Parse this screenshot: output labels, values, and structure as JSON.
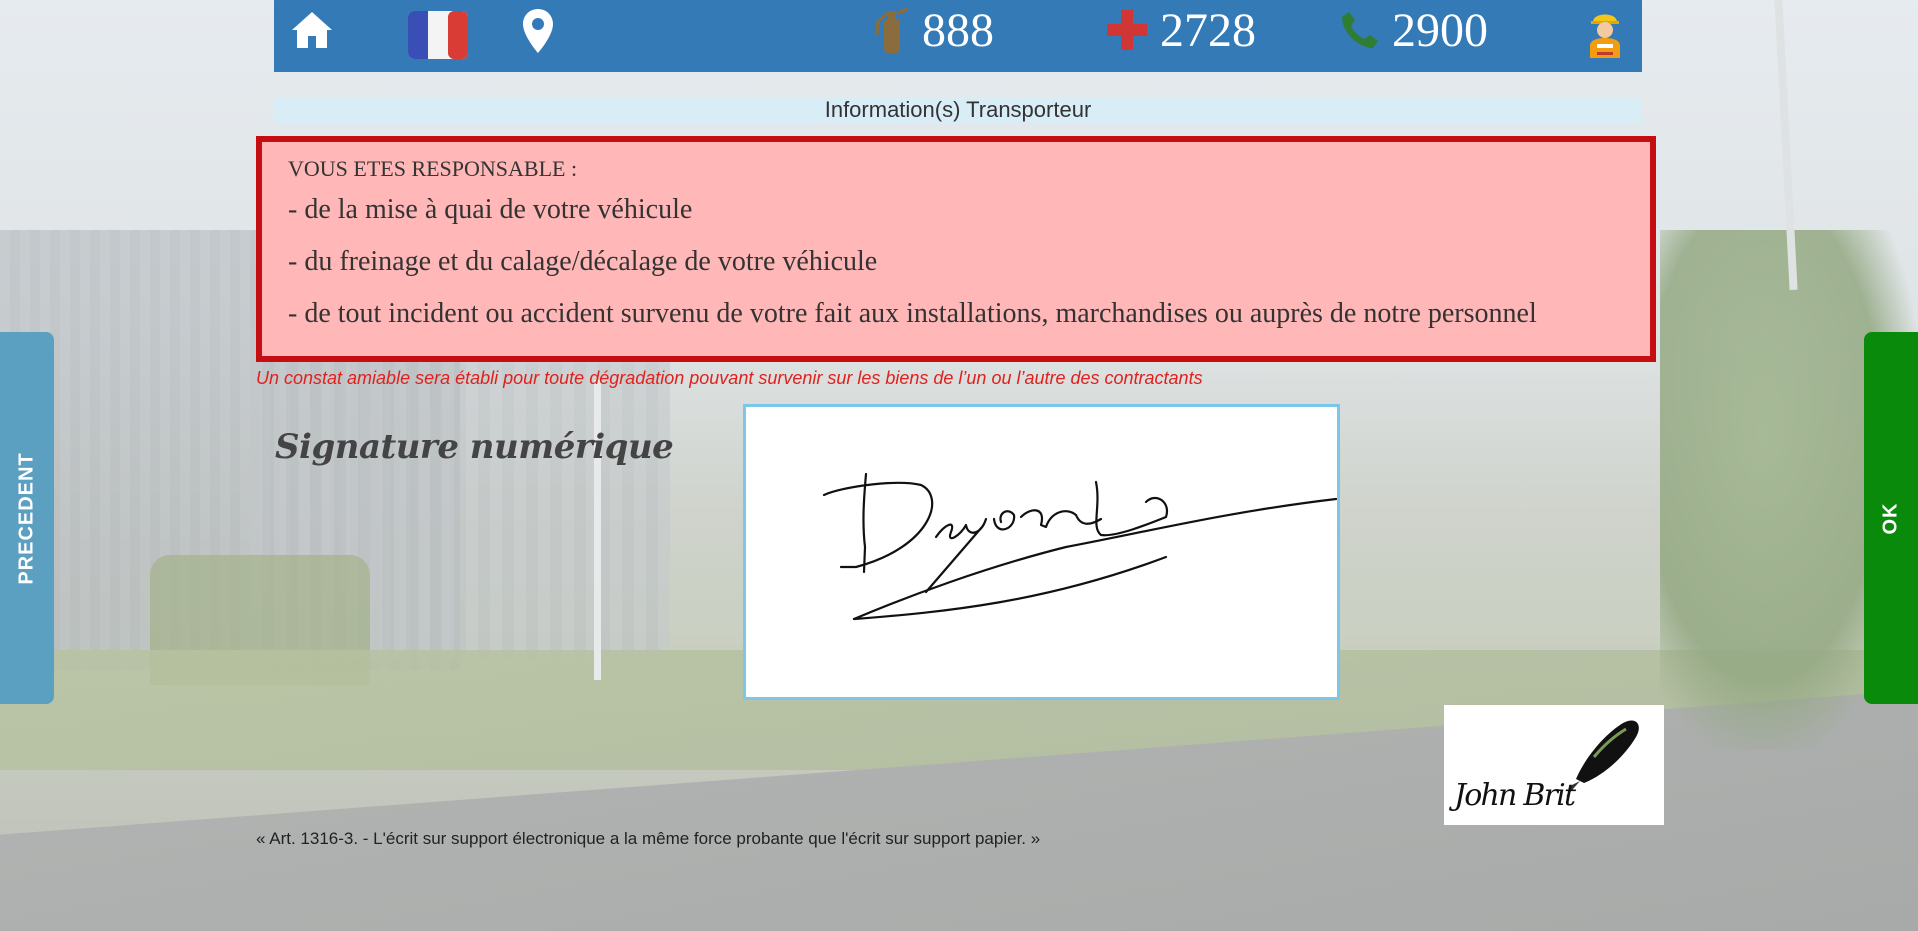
{
  "header": {
    "home_icon": "home-icon",
    "language_icon": "french-flag-icon",
    "location_icon": "map-marker-icon",
    "counters": [
      {
        "icon": "fire-extinguisher-icon",
        "value": "888",
        "color": "#8b6c3c"
      },
      {
        "icon": "red-cross-icon",
        "value": "2728",
        "color": "#d03636"
      },
      {
        "icon": "phone-icon",
        "value": "2900",
        "color": "#2e7d32"
      }
    ],
    "user_icon": "worker-avatar-icon"
  },
  "banner": {
    "title": "Information(s) Transporteur"
  },
  "alert": {
    "heading": "VOUS ETES RESPONSABLE :",
    "lines": [
      "- de la mise à quai de votre véhicule",
      "- du freinage et du calage/décalage de votre véhicule",
      "- de tout incident ou accident survenu de votre fait aux installations, marchandises ou auprès de notre personnel"
    ]
  },
  "notice": "Un constat amiable sera établi pour toute dégradation pouvant survenir sur les biens de l’un ou l’autre des contractants",
  "signature": {
    "title": "Signature numérique",
    "logo_text": "John Brit"
  },
  "law": "« Art. 1316-3. - L'écrit sur support électronique a la même force probante que l'écrit sur support papier. »",
  "nav": {
    "prev_label": "PRECEDENT",
    "ok_label": "OK"
  },
  "colors": {
    "topbar": "#337ab7",
    "alert_border": "#c40e12",
    "ok": "#0a8a0a",
    "prev": "#5b9fc1"
  }
}
